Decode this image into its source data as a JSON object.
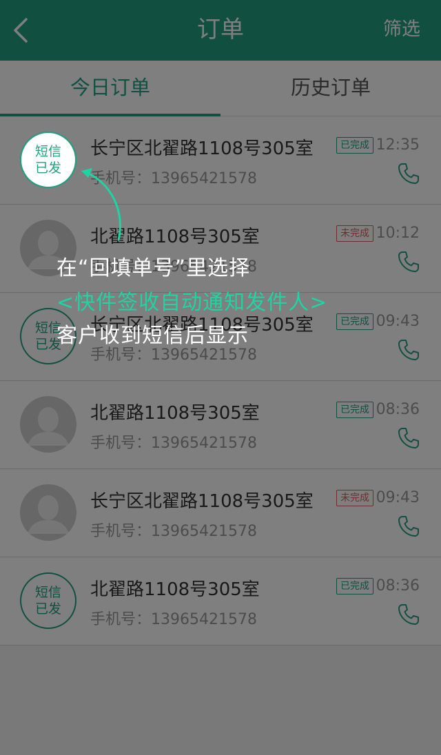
{
  "header": {
    "title": "订单",
    "filter_label": "筛选",
    "back_icon": "chevron-left-icon",
    "background_color": "#22a183"
  },
  "tabs": [
    {
      "label": "今日订单",
      "active": true
    },
    {
      "label": "历史订单",
      "active": false
    }
  ],
  "orders": [
    {
      "badge": "sms",
      "badge_line1": "短信",
      "badge_line2": "已发",
      "address": "长宁区北翟路1108号305室",
      "phone_label": "手机号：",
      "phone": "13965421578",
      "status": "已完成",
      "status_kind": "done",
      "time": "12:35"
    },
    {
      "badge": "avatar",
      "badge_line1": "",
      "badge_line2": "",
      "address": "北翟路1108号305室",
      "phone_label": "手机号：",
      "phone": "13965421578",
      "status": "未完成",
      "status_kind": "pending",
      "time": "10:12"
    },
    {
      "badge": "sms",
      "badge_line1": "短信",
      "badge_line2": "已发",
      "address": "长宁区北翟路1108号305室",
      "phone_label": "手机号：",
      "phone": "13965421578",
      "status": "已完成",
      "status_kind": "done",
      "time": "09:43"
    },
    {
      "badge": "avatar",
      "badge_line1": "",
      "badge_line2": "",
      "address": "北翟路1108号305室",
      "phone_label": "手机号：",
      "phone": "13965421578",
      "status": "已完成",
      "status_kind": "done",
      "time": "08:36"
    },
    {
      "badge": "avatar",
      "badge_line1": "",
      "badge_line2": "",
      "address": "长宁区北翟路1108号305室",
      "phone_label": "手机号：",
      "phone": "13965421578",
      "status": "未完成",
      "status_kind": "pending",
      "time": "09:43"
    },
    {
      "badge": "sms",
      "badge_line1": "短信",
      "badge_line2": "已发",
      "address": "北翟路1108号305室",
      "phone_label": "手机号：",
      "phone": "13965421578",
      "status": "已完成",
      "status_kind": "done",
      "time": "08:36"
    }
  ],
  "overlay": {
    "badge_line1": "短信",
    "badge_line2": "已发",
    "line1": "在“回填单号”里选择",
    "line2": "<快件签收自动通知发件人>",
    "line3": "客户收到短信后显示",
    "accent_color": "#1fd3a3"
  },
  "colors": {
    "accent": "#22a183",
    "done": "#22a183",
    "pending": "#e05a5a"
  }
}
